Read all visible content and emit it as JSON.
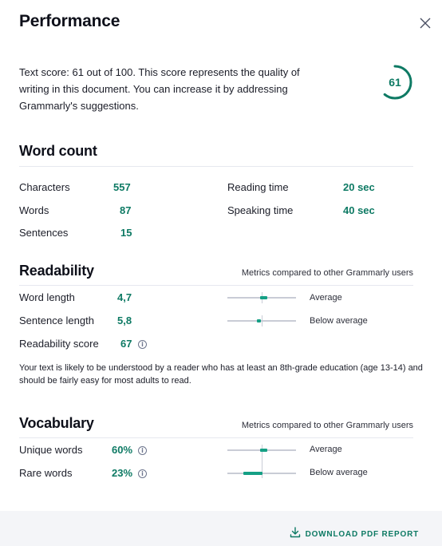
{
  "header": {
    "title": "Performance",
    "close_icon": "close-icon"
  },
  "score": {
    "text": "Text score: 61 out of 100. This score represents the quality of writing in this document. You can increase it by addressing Grammarly's suggestions.",
    "value": "61",
    "fraction": 0.61,
    "color": "#0e7a64"
  },
  "word_count": {
    "title": "Word count",
    "left": [
      {
        "label": "Characters",
        "value": "557"
      },
      {
        "label": "Words",
        "value": "87"
      },
      {
        "label": "Sentences",
        "value": "15"
      }
    ],
    "right": [
      {
        "label": "Reading time",
        "value": "20 sec"
      },
      {
        "label": "Speaking time",
        "value": "40 sec"
      }
    ]
  },
  "readability": {
    "title": "Readability",
    "note": "Metrics compared to other Grammarly users",
    "metrics": [
      {
        "label": "Word length",
        "value": "4,7",
        "level": 0.53,
        "compare": "Average"
      },
      {
        "label": "Sentence length",
        "value": "5,8",
        "level": 0.46,
        "compare": "Below average"
      },
      {
        "label": "Readability score",
        "value": "67"
      }
    ],
    "description": "Your text is likely to be understood by a reader who has at least an 8th-grade education (age 13-14) and should be fairly easy for most adults to read."
  },
  "vocabulary": {
    "title": "Vocabulary",
    "note": "Metrics compared to other Grammarly users",
    "metrics": [
      {
        "label": "Unique words",
        "value": "60%",
        "level": 0.53,
        "compare": "Average"
      },
      {
        "label": "Rare words",
        "value": "23%",
        "level": 0.3,
        "compare": "Below average"
      }
    ]
  },
  "footer": {
    "download_label": "DOWNLOAD PDF REPORT",
    "download_icon": "download-icon"
  },
  "colors": {
    "accent": "#0e7a64",
    "bar_fill": "#15a085",
    "track": "#c9ccd6"
  }
}
